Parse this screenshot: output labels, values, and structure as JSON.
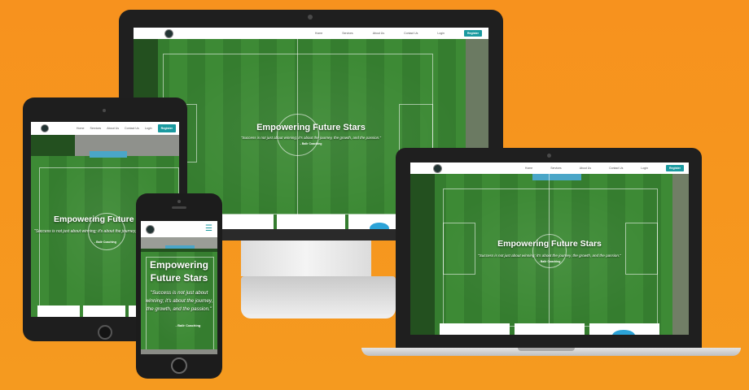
{
  "site": {
    "nav": [
      "Home",
      "Services",
      "About Us",
      "Contact Us",
      "Login"
    ],
    "register": "Register",
    "hero_title": "Empowering Future Stars",
    "hero_title_phone_line1": "Empowering",
    "hero_title_phone_line2": "Future Stars",
    "quote": "\"Success is not just about winning; it's about the journey, the growth, and the passion.\"",
    "author": "- Ballr Coaching"
  },
  "colors": {
    "background": "#f7921e",
    "accent": "#1a9aa0",
    "device_frame": "#1f1f1f"
  },
  "icons": {
    "menu": "hamburger-icon",
    "logo": "logo-icon"
  }
}
